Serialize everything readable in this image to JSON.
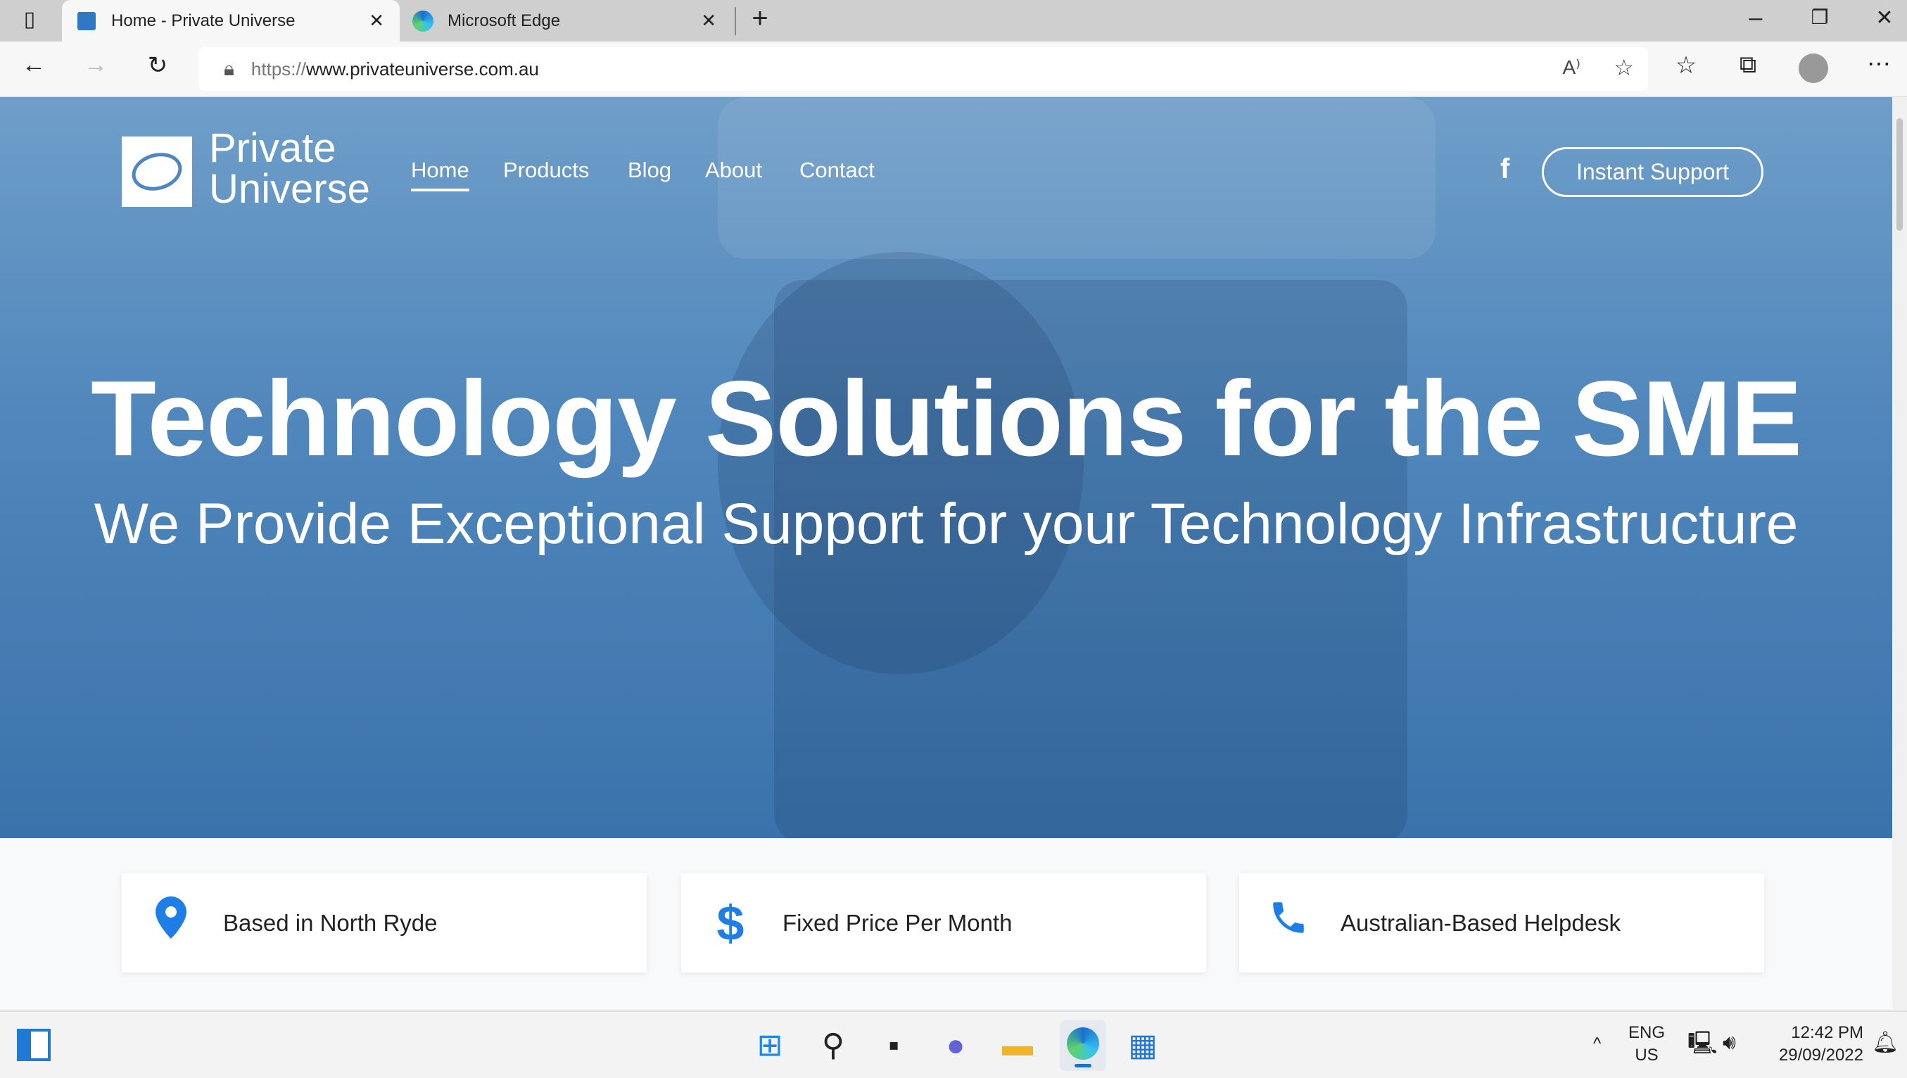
{
  "browser": {
    "tabs": [
      {
        "title": "Home - Private Universe",
        "active": true
      },
      {
        "title": "Microsoft Edge",
        "active": false
      }
    ],
    "url_scheme": "https://",
    "url_host": "www.privateuniverse.com.au",
    "window_controls": [
      "minimize",
      "restore",
      "close"
    ]
  },
  "site": {
    "logo": {
      "line1": "Private",
      "line2": "Universe"
    },
    "nav": [
      {
        "label": "Home",
        "active": true
      },
      {
        "label": "Products"
      },
      {
        "label": "Blog"
      },
      {
        "label": "About"
      },
      {
        "label": "Contact"
      }
    ],
    "social_icon": "facebook-icon",
    "support_button": "Instant Support",
    "headline": "Technology Solutions for the SME",
    "subheadline": "We Provide Exceptional Support for your Technology Infrastructure",
    "features": [
      {
        "icon": "map-pin-icon",
        "label": "Based in North Ryde"
      },
      {
        "icon": "dollar-icon",
        "label": "Fixed Price Per Month"
      },
      {
        "icon": "phone-icon",
        "label": "Australian-Based Helpdesk"
      }
    ],
    "accent": "#1e7ee6",
    "hero_color": "#4f86bb"
  },
  "taskbar": {
    "lang1": "ENG",
    "lang2": "US",
    "time": "12:42 PM",
    "date": "29/09/2022"
  }
}
